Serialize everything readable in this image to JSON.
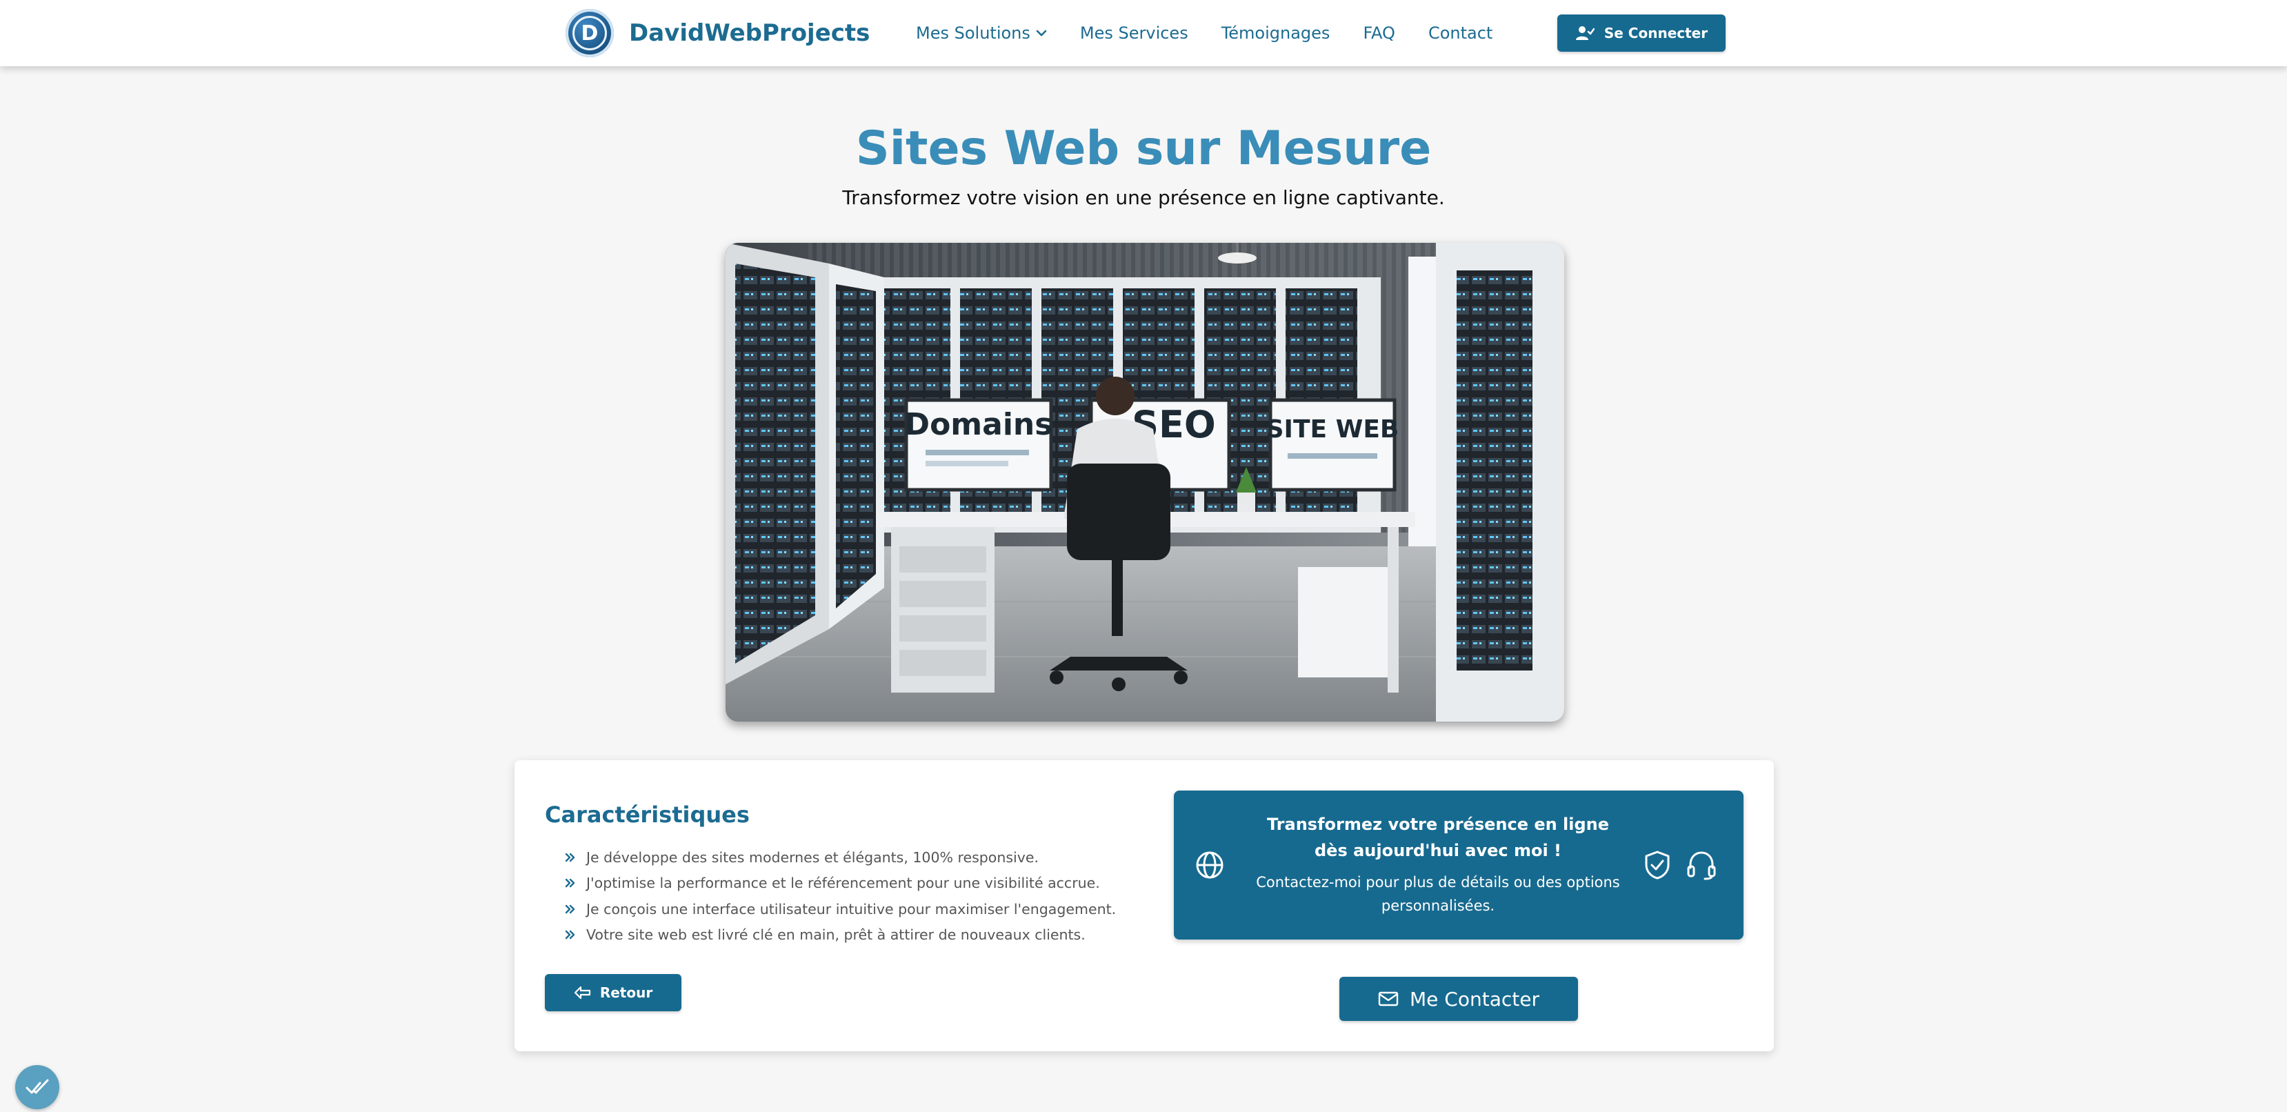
{
  "navbar": {
    "brand_name": "DavidWebProjects",
    "logo_letter": "D",
    "links": [
      {
        "label": "Mes Solutions",
        "has_dropdown": true
      },
      {
        "label": "Mes Services"
      },
      {
        "label": "Témoignages"
      },
      {
        "label": "FAQ"
      },
      {
        "label": "Contact"
      }
    ],
    "login_label": "Se Connecter"
  },
  "hero": {
    "title": "Sites Web sur Mesure",
    "subtitle": "Transformez votre vision en une présence en ligne captivante.",
    "image_texts": {
      "screen_left": "Domains",
      "screen_center": "SEO",
      "screen_right": "SITE WEB"
    }
  },
  "features": {
    "title": "Caractéristiques",
    "items": [
      "Je développe des sites modernes et élégants, 100% responsive.",
      "J'optimise la performance et le référencement pour une visibilité accrue.",
      "Je conçois une interface utilisateur intuitive pour maximiser l'engagement.",
      "Votre site web est livré clé en main, prêt à attirer de nouveaux clients."
    ],
    "back_label": "Retour"
  },
  "cta": {
    "heading": "Transformez votre présence en ligne dès aujourd'hui avec moi !",
    "text": "Contactez-moi pour plus de détails ou des options personnalisées.",
    "contact_label": "Me Contacter"
  },
  "colors": {
    "primary": "#176a8f",
    "title_blue": "#3a8db8",
    "background": "#f6f6f6"
  },
  "icons": [
    "user-check-icon",
    "chevron-down-icon",
    "double-chevron-right-icon",
    "arrow-left-icon",
    "globe-icon",
    "shield-check-icon",
    "headset-icon",
    "mail-icon",
    "check-double-icon"
  ]
}
